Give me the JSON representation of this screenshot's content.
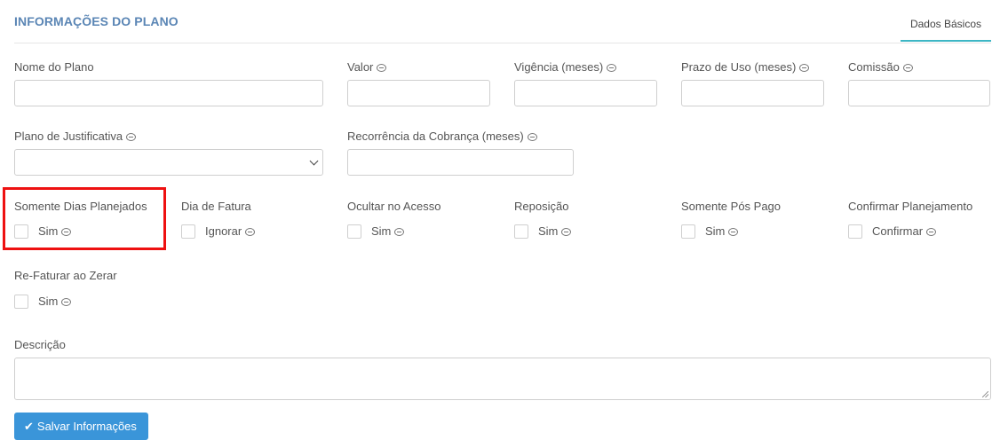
{
  "header": {
    "title": "INFORMAÇÕES DO PLANO",
    "tab": "Dados Básicos"
  },
  "fields": {
    "nome_plano": "Nome do Plano",
    "valor": "Valor",
    "vigencia": "Vigência (meses)",
    "prazo_uso": "Prazo de Uso (meses)",
    "comissao": "Comissão",
    "plano_justificativa": "Plano de Justificativa",
    "recorrencia": "Recorrência da Cobrança (meses)",
    "descricao": "Descrição"
  },
  "checkbox_groups": [
    {
      "label": "Somente Dias Planejados",
      "option": "Sim",
      "checked": false
    },
    {
      "label": "Dia de Fatura",
      "option": "Ignorar",
      "checked": false
    },
    {
      "label": "Ocultar no Acesso",
      "option": "Sim",
      "checked": false
    },
    {
      "label": "Reposição",
      "option": "Sim",
      "checked": false
    },
    {
      "label": "Somente Pós Pago",
      "option": "Sim",
      "checked": false
    },
    {
      "label": "Confirmar Planejamento",
      "option": "Confirmar",
      "checked": false
    },
    {
      "label": "Re-Faturar ao Zerar",
      "option": "Sim",
      "checked": false
    }
  ],
  "actions": {
    "save": "Salvar Informações"
  },
  "colors": {
    "accent": "#3a95d9",
    "tab_underline": "#3db6c4",
    "title": "#5b86b5",
    "highlight": "#ee1111"
  }
}
